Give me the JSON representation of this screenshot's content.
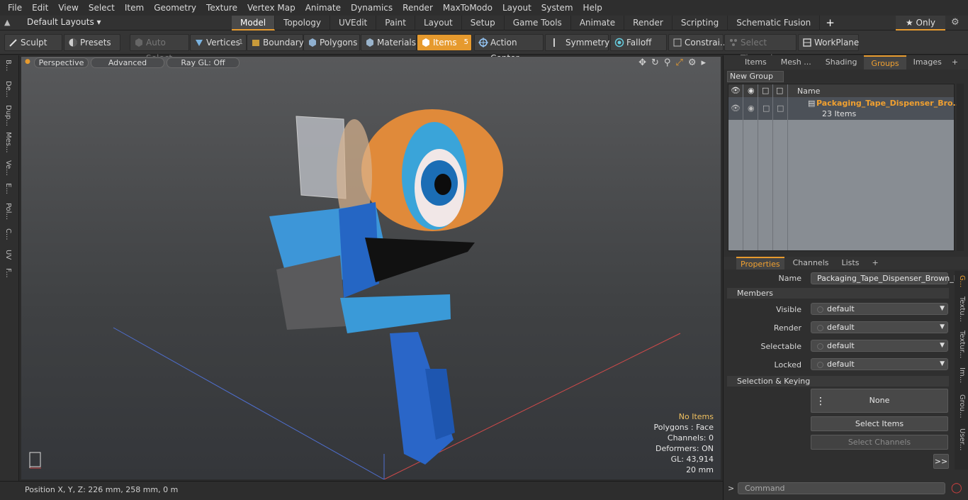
{
  "menu": [
    "File",
    "Edit",
    "View",
    "Select",
    "Item",
    "Geometry",
    "Texture",
    "Vertex Map",
    "Animate",
    "Dynamics",
    "Render",
    "MaxToModo",
    "Layout",
    "System",
    "Help"
  ],
  "layout": {
    "label": "Default Layouts ▾",
    "tabs": [
      "Model",
      "Topology",
      "UVEdit",
      "Paint",
      "Layout",
      "Setup",
      "Game Tools",
      "Animate",
      "Render",
      "Scripting",
      "Schematic Fusion"
    ],
    "only": "★ Only"
  },
  "toolbar": {
    "sculpt": "Sculpt",
    "presets": "Presets",
    "auto_select": "Auto Select",
    "vertices": "Vertices",
    "vertices_count": "1",
    "boundary": "Boundary",
    "polygons": "Polygons",
    "materials": "Materials",
    "items": "Items",
    "items_count": "5",
    "action_center": "Action Center",
    "symmetry": "Symmetry",
    "falloff": "Falloff",
    "constraints": "Constrai...",
    "select_through": "Select Through",
    "workplane": "WorkPlane"
  },
  "leftstrip": [
    "B...",
    "De...",
    "Dup...",
    "Mes...",
    "Ve...",
    "E...",
    "Pol...",
    "C...",
    "UV",
    "F..."
  ],
  "viewport": {
    "perspective": "Perspective",
    "advanced": "Advanced",
    "raygl": "Ray GL: Off"
  },
  "stats": {
    "no_items": "No Items",
    "polygons": "Polygons : Face",
    "channels": "Channels: 0",
    "deformers": "Deformers: ON",
    "gl": "GL: 43,914",
    "scale": "20 mm"
  },
  "status": {
    "position": "Position X, Y, Z:   226 mm, 258 mm, 0 m"
  },
  "right": {
    "tabs": [
      "Items",
      "Mesh ...",
      "Shading",
      "Groups",
      "Images"
    ],
    "new_group": "New Group",
    "col_name": "Name",
    "group_name": "Packaging_Tape_Dispenser_Bro...",
    "group_count": "23 Items"
  },
  "props": {
    "tabs": [
      "Properties",
      "Channels",
      "Lists"
    ],
    "name_label": "Name",
    "name_value": "Packaging_Tape_Dispenser_Brown_La",
    "members": "Members",
    "visible_label": "Visible",
    "render_label": "Render",
    "selectable_label": "Selectable",
    "locked_label": "Locked",
    "default": "default",
    "sel_keying": "Selection & Keying",
    "none": "None",
    "select_items": "Select Items",
    "select_channels": "Select Channels",
    "more": ">>",
    "side_tabs": [
      "G...",
      "Textu...",
      "Textur...",
      "Im...",
      "Grou...",
      "User..."
    ],
    "command": "Command"
  }
}
